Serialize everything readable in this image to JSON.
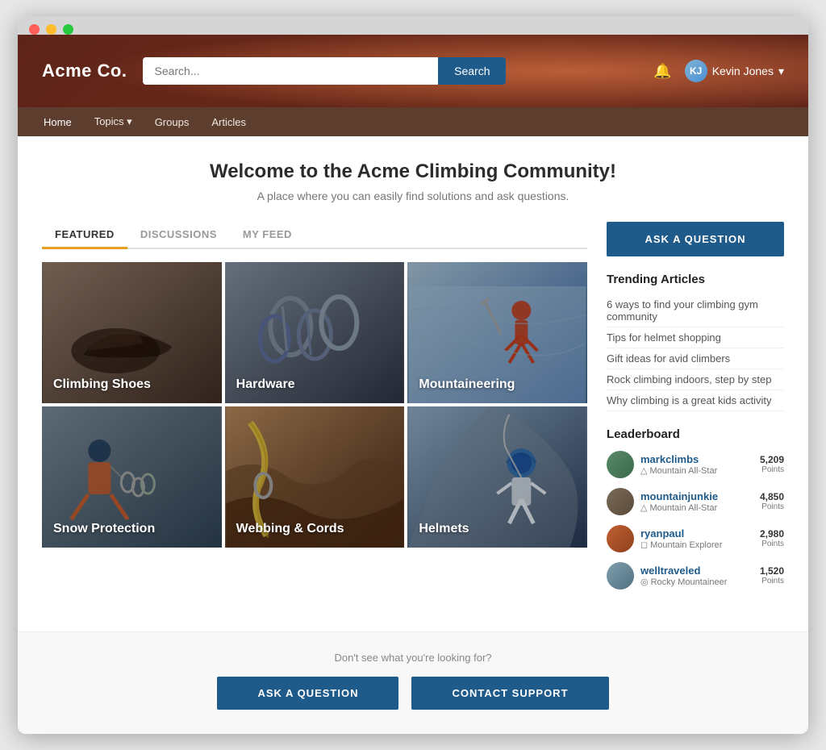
{
  "browser": {
    "dots": [
      "red",
      "yellow",
      "green"
    ]
  },
  "header": {
    "logo": "Acme Co.",
    "search_placeholder": "Search...",
    "search_button": "Search",
    "user_name": "Kevin Jones",
    "user_initials": "KJ"
  },
  "nav": {
    "items": [
      {
        "label": "Home",
        "active": true,
        "has_dropdown": false
      },
      {
        "label": "Topics",
        "active": false,
        "has_dropdown": true
      },
      {
        "label": "Groups",
        "active": false,
        "has_dropdown": false
      },
      {
        "label": "Articles",
        "active": false,
        "has_dropdown": false
      }
    ]
  },
  "page": {
    "title": "Welcome to the Acme Climbing Community!",
    "subtitle": "A place where you can easily find solutions and ask questions."
  },
  "tabs": [
    {
      "label": "FEATURED",
      "active": true
    },
    {
      "label": "DISCUSSIONS",
      "active": false
    },
    {
      "label": "MY FEED",
      "active": false
    }
  ],
  "categories": [
    {
      "id": "climbing-shoes",
      "label": "Climbing Shoes",
      "bg_class": "bg-climbing-shoes"
    },
    {
      "id": "hardware",
      "label": "Hardware",
      "bg_class": "bg-hardware"
    },
    {
      "id": "mountaineering",
      "label": "Mountaineering",
      "bg_class": "bg-mountaineering"
    },
    {
      "id": "snow-protection",
      "label": "Snow Protection",
      "bg_class": "bg-snow-protection"
    },
    {
      "id": "webbing-cords",
      "label": "Webbing & Cords",
      "bg_class": "bg-webbing"
    },
    {
      "id": "helmets",
      "label": "Helmets",
      "bg_class": "bg-helmets"
    }
  ],
  "sidebar": {
    "ask_button": "ASK A QUESTION",
    "trending_title": "Trending Articles",
    "trending_articles": [
      "6 ways to find your climbing gym community",
      "Tips for helmet shopping",
      "Gift ideas for avid climbers",
      "Rock climbing indoors, step by step",
      "Why climbing is a great kids activity"
    ],
    "leaderboard_title": "Leaderboard",
    "leaderboard": [
      {
        "name": "markclimbs",
        "badge": "Mountain All-Star",
        "points": "5,209",
        "points_label": "Points"
      },
      {
        "name": "mountainjunkie",
        "badge": "Mountain All-Star",
        "points": "4,850",
        "points_label": "Points"
      },
      {
        "name": "ryanpaul",
        "badge": "Mountain Explorer",
        "points": "2,980",
        "points_label": "Points"
      },
      {
        "name": "welltraveled",
        "badge": "Rocky Mountaineer",
        "points": "1,520",
        "points_label": "Points"
      }
    ]
  },
  "footer": {
    "text": "Don't see what you're looking for?",
    "ask_button": "ASK A QUESTION",
    "contact_button": "CONTACT SUPPORT"
  }
}
